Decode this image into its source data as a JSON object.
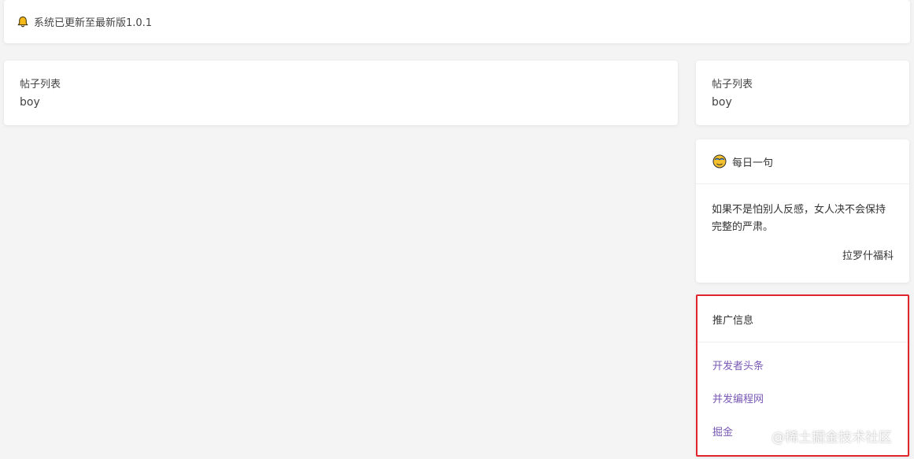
{
  "notice": {
    "icon": "bell-icon",
    "text": "系统已更新至最新版1.0.1"
  },
  "main_post": {
    "title": "帖子列表",
    "author": "boy"
  },
  "side_post": {
    "title": "帖子列表",
    "author": "boy"
  },
  "daily": {
    "icon": "emoji-icon",
    "title": "每日一句",
    "quote": "如果不是怕别人反感，女人决不会保持完整的严肃。",
    "author": "拉罗什福科"
  },
  "promo": {
    "title": "推广信息",
    "links": [
      "开发者头条",
      "并发编程网",
      "掘金"
    ],
    "link_color": "#7a5ab5",
    "highlight_color": "#e0262c"
  },
  "watermark": "@稀土掘金技术社区"
}
